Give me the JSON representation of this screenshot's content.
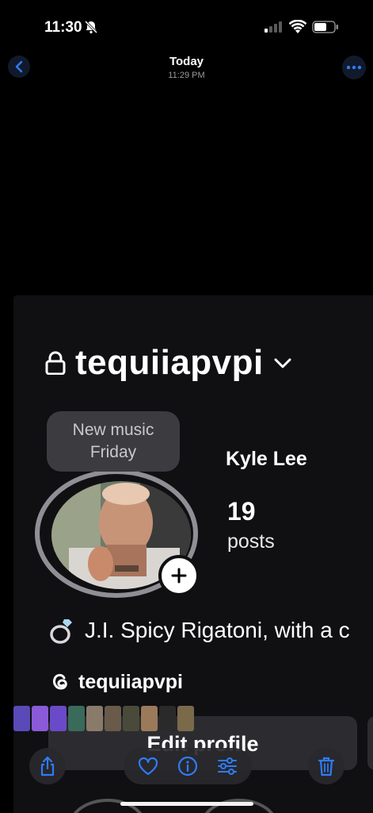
{
  "status_bar": {
    "time": "11:30",
    "icons": [
      "bell-slash-icon",
      "cellular-signal-icon",
      "wifi-icon",
      "battery-icon"
    ]
  },
  "photo_header": {
    "title": "Today",
    "subtitle": "11:29 PM",
    "back_icon": "chevron-left-icon",
    "more_icon": "ellipsis-icon"
  },
  "profile": {
    "username": "tequiiapvpi",
    "note": {
      "line1": "New music",
      "line2": "Friday"
    },
    "display_name": "Kyle Lee",
    "posts_count": "19",
    "posts_label": "posts",
    "bio": "J.I. Spicy Rigatoni, with a c",
    "threads_handle": "tequiiapvpi",
    "edit_profile_label": "Edit profile"
  },
  "toolbar": {
    "icons": [
      "share-icon",
      "heart-icon",
      "info-icon",
      "adjust-icon",
      "trash-icon"
    ]
  },
  "colors": {
    "background": "#000000",
    "accent_blue": "#2f7cf6",
    "panel": "#101013",
    "button": "#2c2c30"
  }
}
